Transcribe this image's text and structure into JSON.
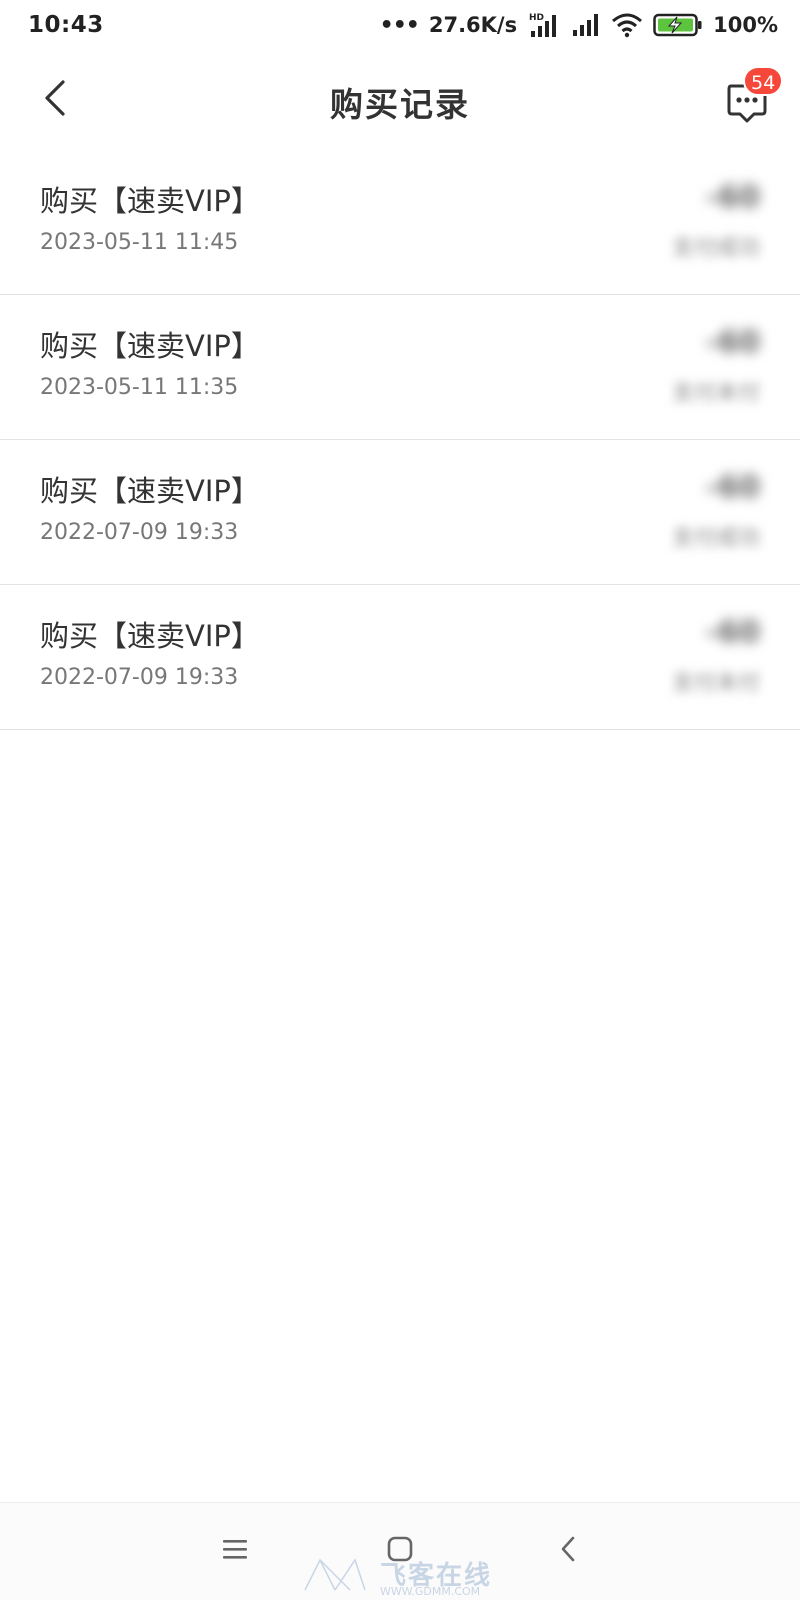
{
  "status_bar": {
    "time": "10:43",
    "dots": "•••",
    "speed": "27.6K/s",
    "network_badge": "HD",
    "battery": "100%"
  },
  "header": {
    "title": "购买记录",
    "message_badge": "54"
  },
  "records": [
    {
      "title": "购买【速卖VIP】",
      "time": "2023-05-11 11:45",
      "amount": "-60",
      "status": "支付成功"
    },
    {
      "title": "购买【速卖VIP】",
      "time": "2023-05-11 11:35",
      "amount": "-60",
      "status": "支付未付"
    },
    {
      "title": "购买【速卖VIP】",
      "time": "2022-07-09 19:33",
      "amount": "-60",
      "status": "支付成功"
    },
    {
      "title": "购买【速卖VIP】",
      "time": "2022-07-09 19:33",
      "amount": "-60",
      "status": "支付未付"
    }
  ],
  "watermark": {
    "text": "飞客在线",
    "url": "WWW.GDMM.COM"
  },
  "icons": {
    "back": "chevron-left-icon",
    "message": "chat-bubble-icon",
    "nav_menu": "menu-icon",
    "nav_home": "home-square-icon",
    "nav_back": "back-chevron-icon"
  },
  "colors": {
    "badge": "#f5483b",
    "text_primary": "#333333",
    "text_secondary": "#777777",
    "divider": "#e3e3e3",
    "battery_fill": "#5cc43d"
  }
}
